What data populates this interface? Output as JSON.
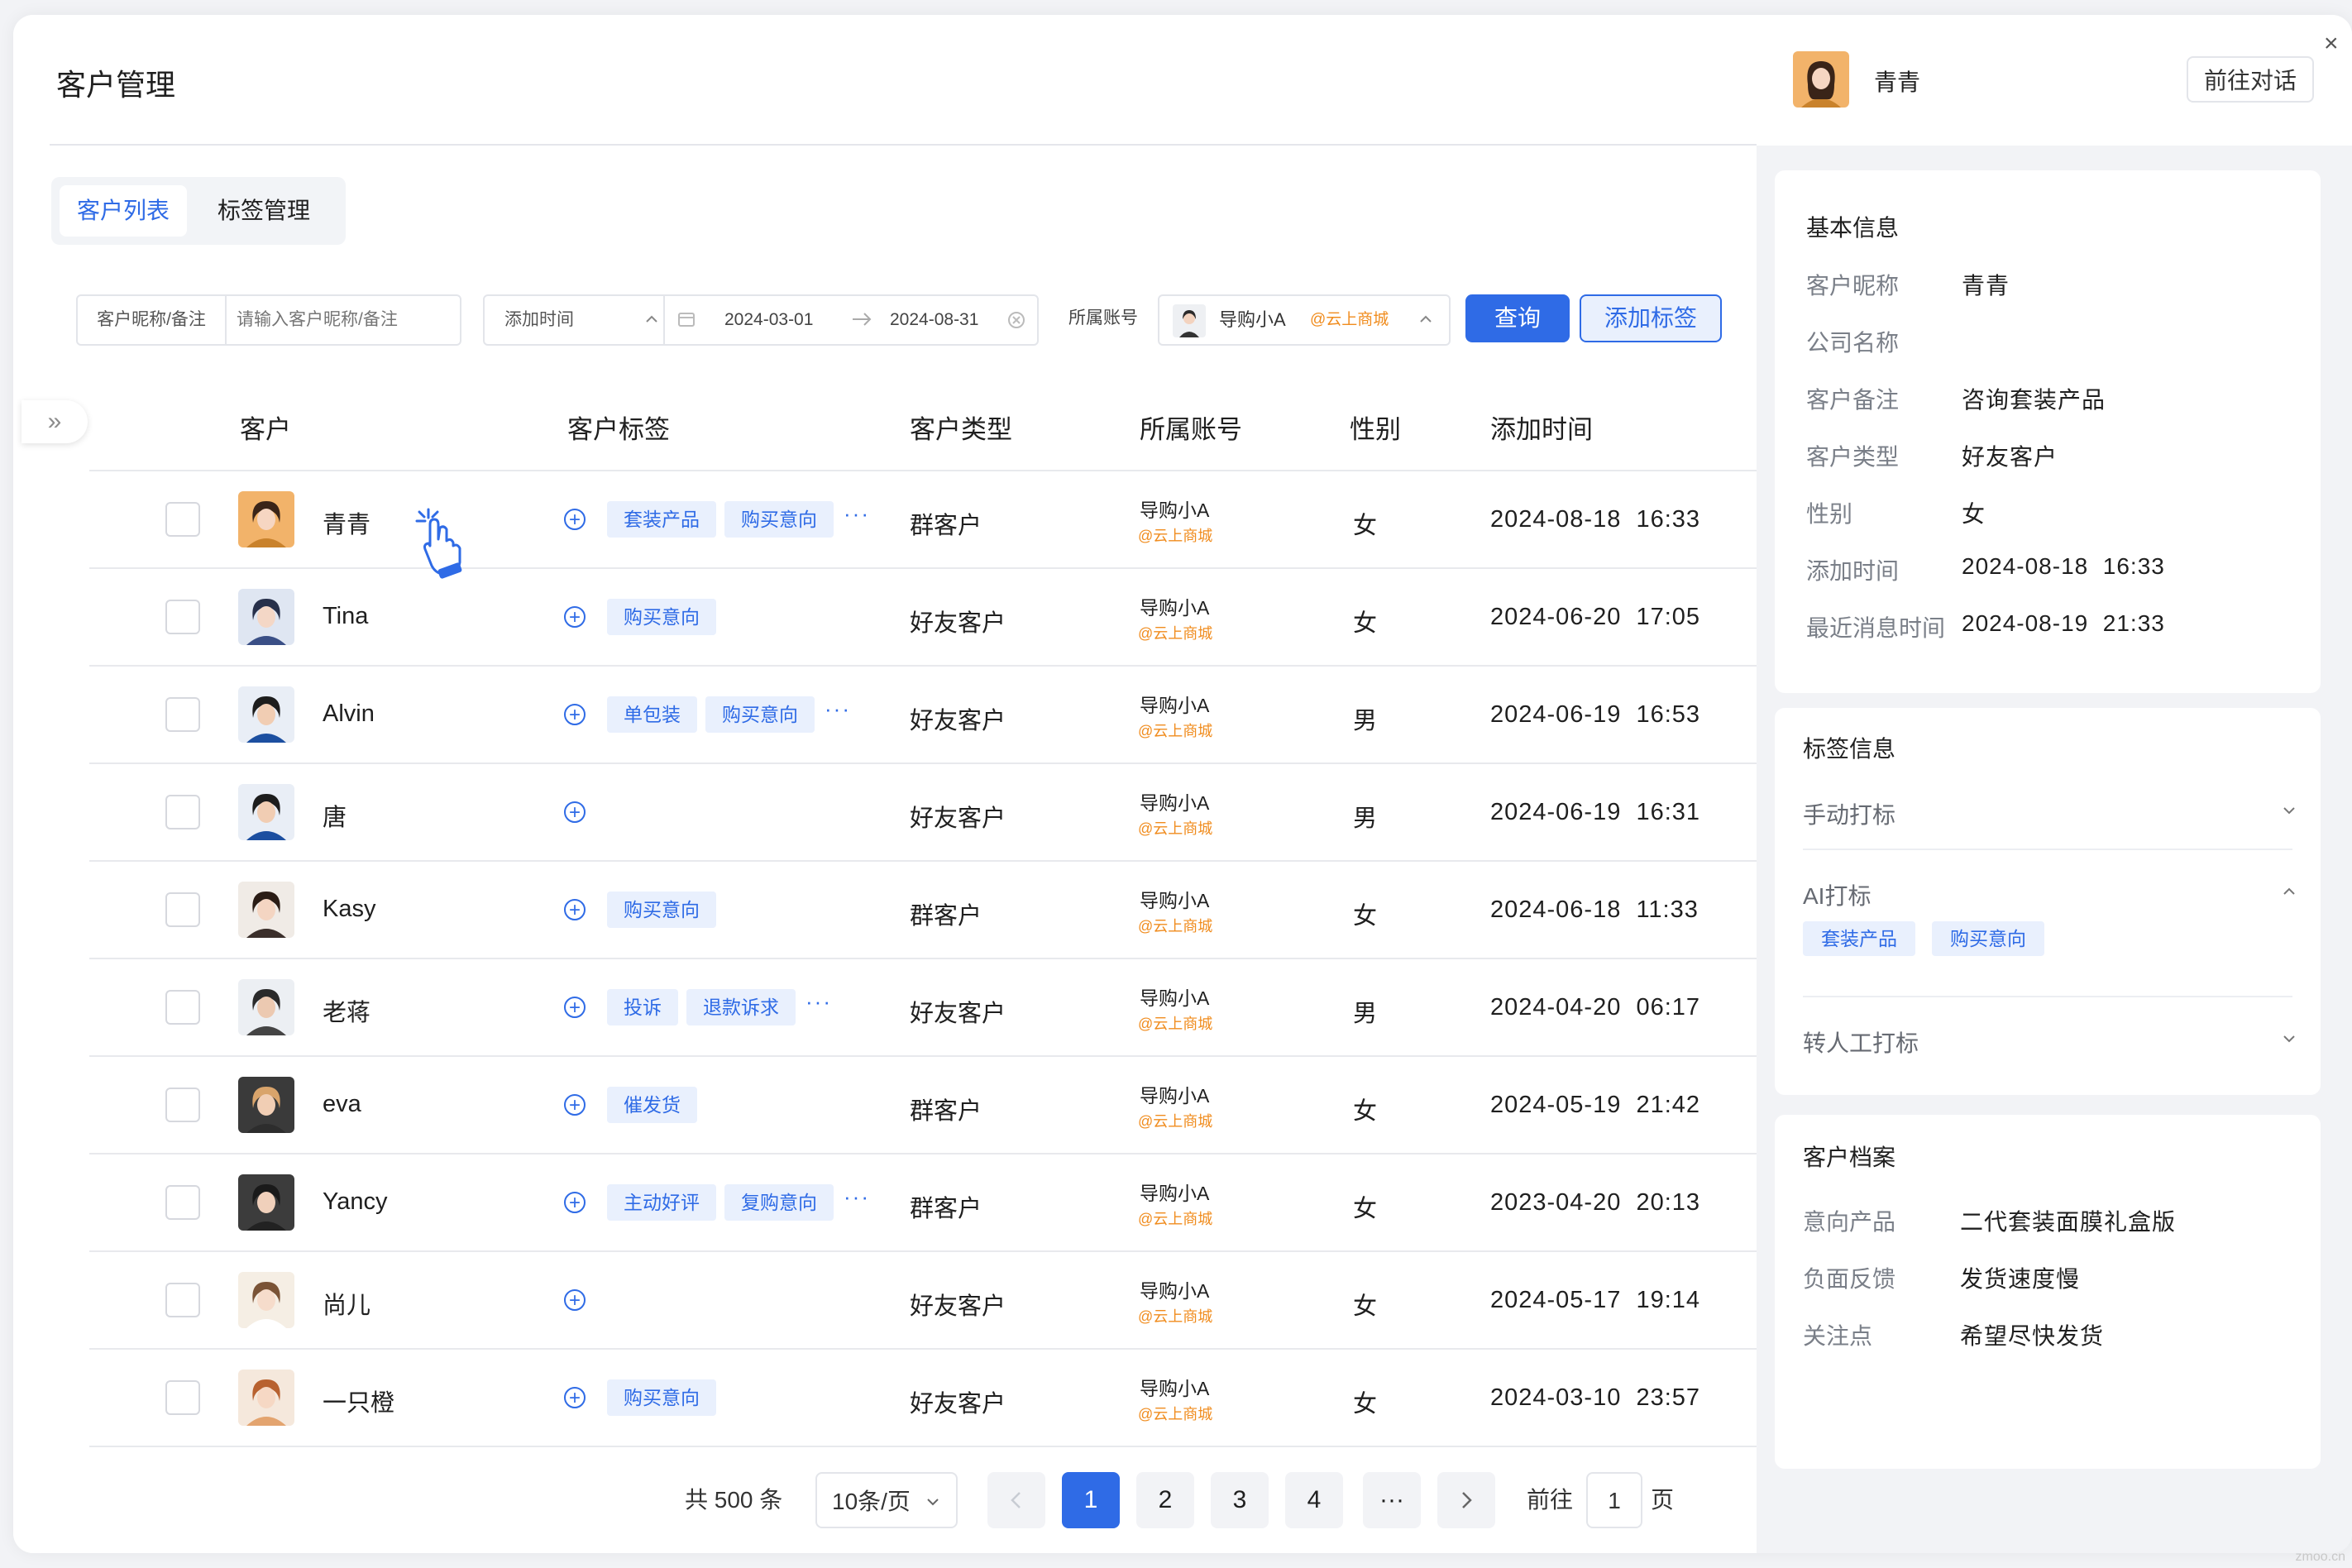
{
  "page_title": "客户管理",
  "tabs": [
    {
      "label": "客户列表",
      "active": true
    },
    {
      "label": "标签管理",
      "active": false
    }
  ],
  "filters": {
    "nickname_label": "客户昵称/备注",
    "nickname_placeholder": "请输入客户昵称/备注",
    "time_label": "添加时间",
    "date_start": "2024-03-01",
    "date_end": "2024-08-31",
    "account_label": "所属账号",
    "account_name": "导购小A",
    "account_shop": "@云上商城",
    "query_button": "查询",
    "add_tag_button": "添加标签"
  },
  "table": {
    "columns": [
      "客户",
      "客户标签",
      "客户类型",
      "所属账号",
      "性别",
      "添加时间"
    ],
    "rows": [
      {
        "name": "青青",
        "tags": [
          "套装产品",
          "购买意向"
        ],
        "more": true,
        "type": "群客户",
        "account": "导购小A",
        "shop": "@云上商城",
        "gender": "女",
        "time": "2024-08-18  16:33"
      },
      {
        "name": "Tina",
        "tags": [
          "购买意向"
        ],
        "more": false,
        "type": "好友客户",
        "account": "导购小A",
        "shop": "@云上商城",
        "gender": "女",
        "time": "2024-06-20  17:05"
      },
      {
        "name": "Alvin",
        "tags": [
          "单包装",
          "购买意向"
        ],
        "more": true,
        "type": "好友客户",
        "account": "导购小A",
        "shop": "@云上商城",
        "gender": "男",
        "time": "2024-06-19  16:53"
      },
      {
        "name": "唐",
        "tags": [],
        "more": false,
        "type": "好友客户",
        "account": "导购小A",
        "shop": "@云上商城",
        "gender": "男",
        "time": "2024-06-19  16:31"
      },
      {
        "name": "Kasy",
        "tags": [
          "购买意向"
        ],
        "more": false,
        "type": "群客户",
        "account": "导购小A",
        "shop": "@云上商城",
        "gender": "女",
        "time": "2024-06-18  11:33"
      },
      {
        "name": "老蒋",
        "tags": [
          "投诉",
          "退款诉求"
        ],
        "more": true,
        "type": "好友客户",
        "account": "导购小A",
        "shop": "@云上商城",
        "gender": "男",
        "time": "2024-04-20  06:17"
      },
      {
        "name": "eva",
        "tags": [
          "催发货"
        ],
        "more": false,
        "type": "群客户",
        "account": "导购小A",
        "shop": "@云上商城",
        "gender": "女",
        "time": "2024-05-19  21:42"
      },
      {
        "name": "Yancy",
        "tags": [
          "主动好评",
          "复购意向"
        ],
        "more": true,
        "type": "群客户",
        "account": "导购小A",
        "shop": "@云上商城",
        "gender": "女",
        "time": "2023-04-20  20:13"
      },
      {
        "name": "尚儿",
        "tags": [],
        "more": false,
        "type": "好友客户",
        "account": "导购小A",
        "shop": "@云上商城",
        "gender": "女",
        "time": "2024-05-17  19:14"
      },
      {
        "name": "一只橙",
        "tags": [
          "购买意向"
        ],
        "more": false,
        "type": "好友客户",
        "account": "导购小A",
        "shop": "@云上商城",
        "gender": "女",
        "time": "2024-03-10  23:57"
      }
    ]
  },
  "pagination": {
    "total": "共 500 条",
    "page_size": "10条/页",
    "pages": [
      "1",
      "2",
      "3",
      "4"
    ],
    "ellipsis": "···",
    "current": "1",
    "goto_label": "前往",
    "goto_value": "1",
    "goto_unit": "页"
  },
  "panel": {
    "name": "青青",
    "chat_button": "前往对话",
    "basic": {
      "title": "基本信息",
      "fields": [
        {
          "key": "客户昵称",
          "value": "青青"
        },
        {
          "key": "公司名称",
          "value": ""
        },
        {
          "key": "客户备注",
          "value": "咨询套装产品"
        },
        {
          "key": "客户类型",
          "value": "好友客户"
        },
        {
          "key": "性别",
          "value": "女"
        },
        {
          "key": "添加时间",
          "value": "2024-08-18  16:33"
        },
        {
          "key": "最近消息时间",
          "value": "2024-08-19  21:33"
        }
      ]
    },
    "tags": {
      "title": "标签信息",
      "sections": [
        {
          "label": "手动打标",
          "expanded": false,
          "tags": []
        },
        {
          "label": "AI打标",
          "expanded": true,
          "tags": [
            "套装产品",
            "购买意向"
          ]
        },
        {
          "label": "转人工打标",
          "expanded": false,
          "tags": []
        }
      ]
    },
    "profile": {
      "title": "客户档案",
      "fields": [
        {
          "key": "意向产品",
          "value": "二代套装面膜礼盒版"
        },
        {
          "key": "负面反馈",
          "value": "发货速度慢"
        },
        {
          "key": "关注点",
          "value": "希望尽快发货"
        }
      ]
    }
  },
  "colors": {
    "accent": "#2f6be6",
    "shop": "#f08c1e",
    "tag_bg": "#e9f0fd"
  }
}
